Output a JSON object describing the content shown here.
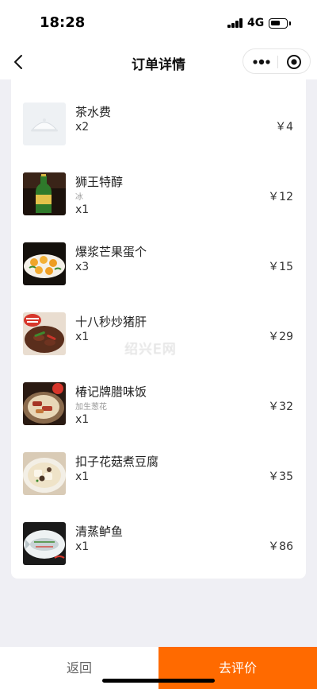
{
  "status_bar": {
    "time": "18:28",
    "network": "4G"
  },
  "nav": {
    "title": "订单详情"
  },
  "items": [
    {
      "name": "茶水费",
      "note": "",
      "qty": "x2",
      "price": "￥4"
    },
    {
      "name": "狮王特醇",
      "note": "冰",
      "qty": "x1",
      "price": "￥12"
    },
    {
      "name": "爆浆芒果蛋个",
      "note": "",
      "qty": "x3",
      "price": "￥15"
    },
    {
      "name": "十八秒炒猪肝",
      "note": "",
      "qty": "x1",
      "price": "￥29"
    },
    {
      "name": "椿记牌腊味饭",
      "note": "加生葱花",
      "qty": "x1",
      "price": "￥32"
    },
    {
      "name": "扣子花菇煮豆腐",
      "note": "",
      "qty": "x1",
      "price": "￥35"
    },
    {
      "name": "清蒸鲈鱼",
      "note": "",
      "qty": "x1",
      "price": "￥86"
    }
  ],
  "watermark": "绍兴E网",
  "bottom": {
    "back_label": "返回",
    "review_label": "去评价"
  },
  "colors": {
    "accent": "#ff6a00",
    "background": "#efeff4"
  },
  "icons": [
    "back-arrow-icon",
    "more-dots-icon",
    "close-circle-icon",
    "signal-icon",
    "battery-icon"
  ]
}
